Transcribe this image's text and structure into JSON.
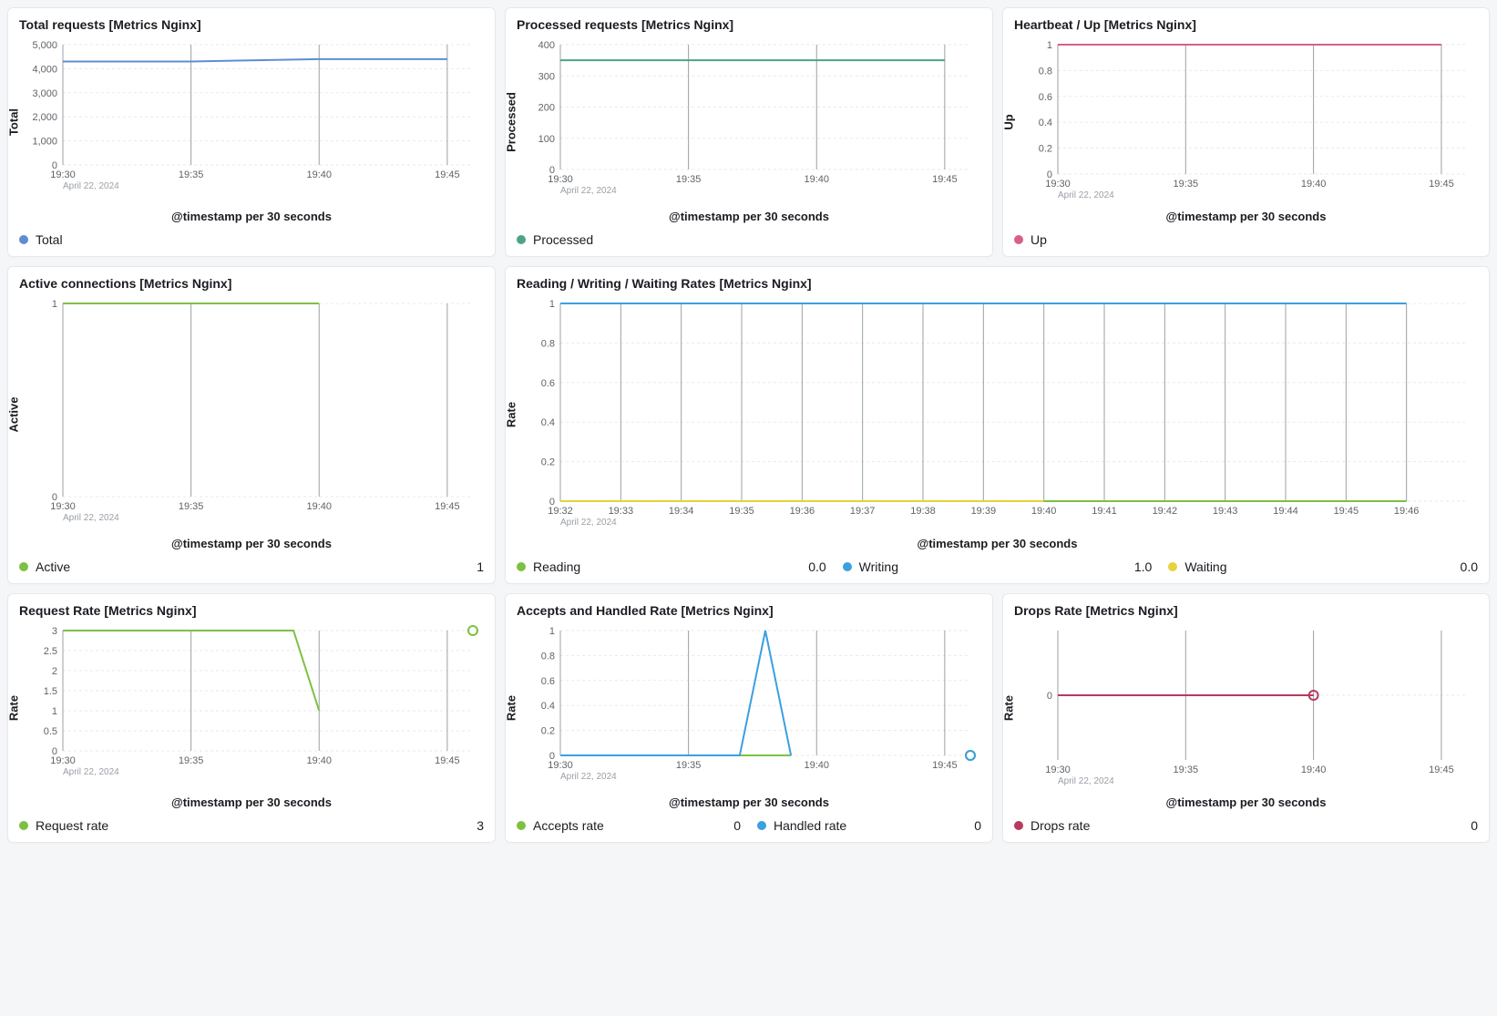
{
  "common": {
    "xlabel": "@timestamp per 30 seconds",
    "date_label": "April 22, 2024"
  },
  "panels": {
    "total": {
      "title": "Total requests [Metrics Nginx]",
      "ylabel": "Total",
      "legend": [
        {
          "label": "Total",
          "color": "#5f8dd3"
        }
      ]
    },
    "processed": {
      "title": "Processed requests [Metrics Nginx]",
      "ylabel": "Processed",
      "legend": [
        {
          "label": "Processed",
          "color": "#4da38a"
        }
      ]
    },
    "heartbeat": {
      "title": "Heartbeat / Up [Metrics Nginx]",
      "ylabel": "Up",
      "legend": [
        {
          "label": "Up",
          "color": "#d6608a"
        }
      ]
    },
    "active": {
      "title": "Active connections [Metrics Nginx]",
      "ylabel": "Active",
      "legend": [
        {
          "label": "Active",
          "color": "#7cc142",
          "value": "1"
        }
      ]
    },
    "rww": {
      "title": "Reading / Writing / Waiting Rates [Metrics Nginx]",
      "ylabel": "Rate",
      "legend": [
        {
          "label": "Reading",
          "color": "#7cc142",
          "value": "0.0"
        },
        {
          "label": "Writing",
          "color": "#3aa0e0",
          "value": "1.0"
        },
        {
          "label": "Waiting",
          "color": "#e6d23a",
          "value": "0.0"
        }
      ]
    },
    "reqrate": {
      "title": "Request Rate [Metrics Nginx]",
      "ylabel": "Rate",
      "legend": [
        {
          "label": "Request rate",
          "color": "#7cc142",
          "value": "3"
        }
      ]
    },
    "accepts": {
      "title": "Accepts and Handled Rate [Metrics Nginx]",
      "ylabel": "Rate",
      "legend": [
        {
          "label": "Accepts rate",
          "color": "#7cc142",
          "value": "0"
        },
        {
          "label": "Handled rate",
          "color": "#3aa0e0",
          "value": "0"
        }
      ]
    },
    "drops": {
      "title": "Drops Rate [Metrics Nginx]",
      "ylabel": "Rate",
      "legend": [
        {
          "label": "Drops rate",
          "color": "#b83a5e",
          "value": "0"
        }
      ]
    }
  },
  "chart_data": [
    {
      "id": "total",
      "type": "line",
      "x_ticks": [
        "19:30",
        "19:35",
        "19:40",
        "19:45"
      ],
      "y_ticks": [
        0,
        1000,
        2000,
        3000,
        4000,
        5000
      ],
      "ylim": [
        0,
        5000
      ],
      "series": [
        {
          "name": "Total",
          "color": "#5f8dd3",
          "x": [
            "19:30",
            "19:35",
            "19:40",
            "19:45"
          ],
          "y": [
            4300,
            4300,
            4400,
            4400
          ]
        }
      ],
      "xlabel": "@timestamp per 30 seconds",
      "ylabel": "Total"
    },
    {
      "id": "processed",
      "type": "line",
      "x_ticks": [
        "19:30",
        "19:35",
        "19:40",
        "19:45"
      ],
      "y_ticks": [
        0,
        100,
        200,
        300,
        400
      ],
      "ylim": [
        0,
        400
      ],
      "series": [
        {
          "name": "Processed",
          "color": "#4da38a",
          "x": [
            "19:30",
            "19:35",
            "19:40",
            "19:45"
          ],
          "y": [
            350,
            350,
            350,
            350
          ]
        }
      ],
      "xlabel": "@timestamp per 30 seconds",
      "ylabel": "Processed"
    },
    {
      "id": "heartbeat",
      "type": "line",
      "x_ticks": [
        "19:30",
        "19:35",
        "19:40",
        "19:45"
      ],
      "y_ticks": [
        0,
        0.2,
        0.4,
        0.6,
        0.8,
        1
      ],
      "ylim": [
        0,
        1
      ],
      "series": [
        {
          "name": "Up",
          "color": "#d6608a",
          "x": [
            "19:30",
            "19:35",
            "19:40",
            "19:45"
          ],
          "y": [
            1,
            1,
            1,
            1
          ]
        }
      ],
      "xlabel": "@timestamp per 30 seconds",
      "ylabel": "Up"
    },
    {
      "id": "active",
      "type": "line",
      "x_ticks": [
        "19:30",
        "19:35",
        "19:40",
        "19:45"
      ],
      "y_ticks": [
        0,
        1
      ],
      "ylim": [
        0,
        1
      ],
      "series": [
        {
          "name": "Active",
          "color": "#7cc142",
          "x": [
            "19:30",
            "19:35",
            "19:40",
            "19:45",
            "19:46"
          ],
          "y": [
            1,
            1,
            1,
            null,
            1
          ]
        }
      ],
      "xlabel": "@timestamp per 30 seconds",
      "ylabel": "Active"
    },
    {
      "id": "rww",
      "type": "line",
      "x_ticks": [
        "19:32",
        "19:33",
        "19:34",
        "19:35",
        "19:36",
        "19:37",
        "19:38",
        "19:39",
        "19:40",
        "19:41",
        "19:42",
        "19:43",
        "19:44",
        "19:45",
        "19:46"
      ],
      "y_ticks": [
        0.0,
        0.2,
        0.4,
        0.6,
        0.8,
        1.0
      ],
      "ylim": [
        0,
        1
      ],
      "series": [
        {
          "name": "Reading",
          "color": "#7cc142",
          "x": [
            "19:32",
            "19:40",
            "19:46"
          ],
          "y": [
            0,
            0,
            0
          ]
        },
        {
          "name": "Writing",
          "color": "#3aa0e0",
          "x": [
            "19:32",
            "19:40",
            "19:46"
          ],
          "y": [
            1,
            1,
            1
          ]
        },
        {
          "name": "Waiting",
          "color": "#e6d23a",
          "x": [
            "19:32",
            "19:40",
            "19:46"
          ],
          "y": [
            0,
            0,
            null
          ]
        }
      ],
      "xlabel": "@timestamp per 30 seconds",
      "ylabel": "Rate"
    },
    {
      "id": "reqrate",
      "type": "line",
      "x_ticks": [
        "19:30",
        "19:35",
        "19:40",
        "19:45"
      ],
      "y_ticks": [
        0,
        0.5,
        1,
        1.5,
        2,
        2.5,
        3
      ],
      "ylim": [
        0,
        3
      ],
      "series": [
        {
          "name": "Request rate",
          "color": "#7cc142",
          "x": [
            "19:30",
            "19:33",
            "19:39",
            "19:40",
            "19:45",
            "19:46"
          ],
          "y": [
            3,
            3,
            3,
            1,
            null,
            3
          ]
        }
      ],
      "marker_last": true,
      "xlabel": "@timestamp per 30 seconds",
      "ylabel": "Rate"
    },
    {
      "id": "accepts",
      "type": "line",
      "x_ticks": [
        "19:30",
        "19:35",
        "19:40",
        "19:45"
      ],
      "y_ticks": [
        0,
        0.2,
        0.4,
        0.6,
        0.8,
        1
      ],
      "ylim": [
        0,
        1
      ],
      "series": [
        {
          "name": "Accepts rate",
          "color": "#7cc142",
          "x": [
            "19:30",
            "19:37",
            "19:38",
            "19:39",
            "19:45",
            "19:46"
          ],
          "y": [
            0,
            0,
            0,
            0,
            null,
            0
          ]
        },
        {
          "name": "Handled rate",
          "color": "#3aa0e0",
          "x": [
            "19:30",
            "19:37",
            "19:38",
            "19:39",
            "19:45",
            "19:46"
          ],
          "y": [
            0,
            0,
            1,
            0,
            null,
            0
          ]
        }
      ],
      "marker_last": true,
      "xlabel": "@timestamp per 30 seconds",
      "ylabel": "Rate"
    },
    {
      "id": "drops",
      "type": "line",
      "x_ticks": [
        "19:30",
        "19:35",
        "19:40",
        "19:45"
      ],
      "y_ticks": [
        0
      ],
      "ylim": [
        -1,
        1
      ],
      "series": [
        {
          "name": "Drops rate",
          "color": "#b83a5e",
          "x": [
            "19:30",
            "19:40",
            "19:46"
          ],
          "y": [
            0,
            0,
            null
          ]
        }
      ],
      "marker_last": true,
      "xlabel": "@timestamp per 30 seconds",
      "ylabel": "Rate"
    }
  ]
}
